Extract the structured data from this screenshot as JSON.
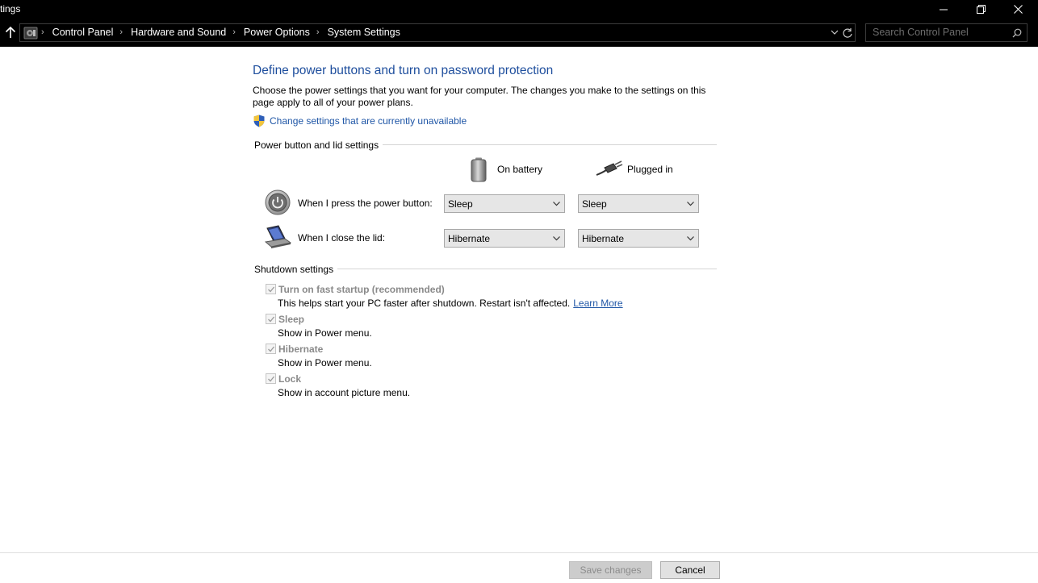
{
  "window": {
    "title": "tings"
  },
  "address": {
    "breadcrumbs": [
      "Control Panel",
      "Hardware and Sound",
      "Power Options",
      "System Settings"
    ],
    "search_placeholder": "Search Control Panel"
  },
  "main": {
    "heading": "Define power buttons and turn on password protection",
    "description": "Choose the power settings that you want for your computer. The changes you make to the settings on this page apply to all of your power plans.",
    "change_link": "Change settings that are currently unavailable"
  },
  "power_section": {
    "title": "Power button and lid settings",
    "col_battery": "On battery",
    "col_plugged": "Plugged in",
    "rows": [
      {
        "label": "When I press the power button:",
        "battery": "Sleep",
        "plugged": "Sleep"
      },
      {
        "label": "When I close the lid:",
        "battery": "Hibernate",
        "plugged": "Hibernate"
      }
    ]
  },
  "shutdown_section": {
    "title": "Shutdown settings",
    "items": [
      {
        "title": "Turn on fast startup (recommended)",
        "desc": "This helps start your PC faster after shutdown. Restart isn't affected.",
        "link": "Learn More",
        "checked": true
      },
      {
        "title": "Sleep",
        "desc": "Show in Power menu.",
        "checked": true
      },
      {
        "title": "Hibernate",
        "desc": "Show in Power menu.",
        "checked": true
      },
      {
        "title": "Lock",
        "desc": "Show in account picture menu.",
        "checked": true
      }
    ]
  },
  "footer": {
    "save_label": "Save changes",
    "cancel_label": "Cancel"
  },
  "colors": {
    "heading_blue": "#1e4e9d",
    "link_blue": "#1f56a6",
    "titlebar_bg": "#000000"
  }
}
